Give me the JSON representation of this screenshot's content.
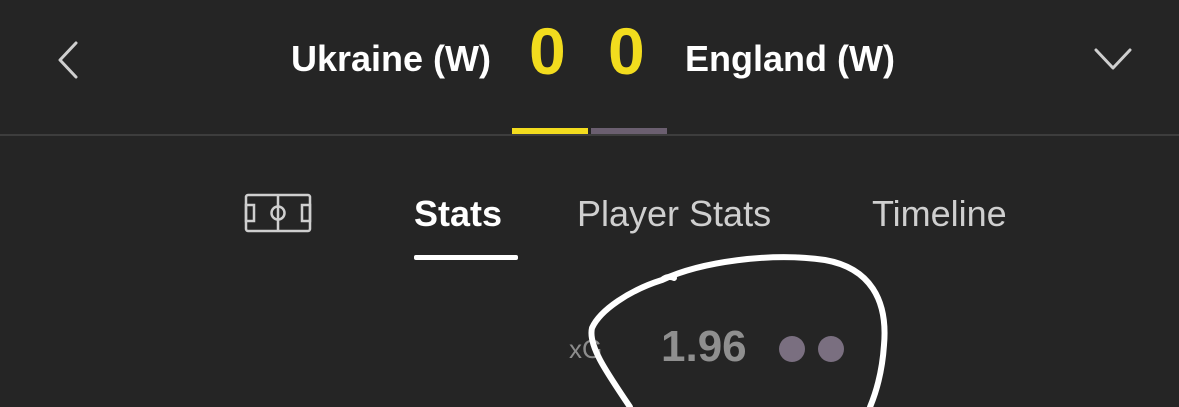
{
  "header": {
    "home_team": "Ukraine (W)",
    "away_team": "England (W)",
    "home_score": "0",
    "away_score": "0",
    "back_icon": "chevron-left-icon",
    "expand_icon": "chevron-down-icon"
  },
  "tabs": [
    {
      "icon": "pitch-icon"
    },
    {
      "label": "Stats",
      "active": true
    },
    {
      "label": "Player Stats",
      "active": false
    },
    {
      "label": "Timeline",
      "active": false
    }
  ],
  "stats": [
    {
      "label": "xG",
      "value": "1.96"
    }
  ],
  "colors": {
    "background": "#252525",
    "score": "#f2dc1e",
    "home_team": "#f2dc1e",
    "away_team": "#6b5f70",
    "dot": "#7a6f80",
    "annotation": "#ffffff"
  }
}
